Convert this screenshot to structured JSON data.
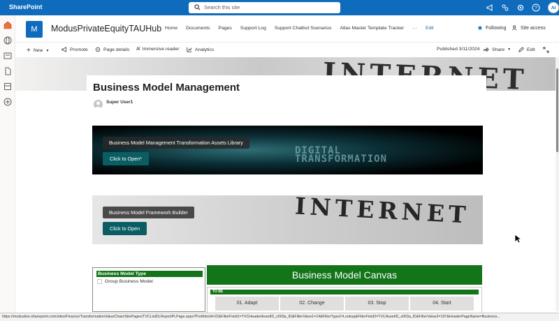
{
  "suitebar": {
    "brand": "SharePoint",
    "search_placeholder": "Search this site",
    "avatar_initials": "AI"
  },
  "site": {
    "logo_letter": "M",
    "title": "ModusPrivateEquityTAUHub",
    "nav": [
      "Home",
      "Documents",
      "Pages",
      "Support Log",
      "Support Chatbot Scenarios",
      "Atlas Master Template Tracker",
      "···",
      "Edit"
    ],
    "following": "Following",
    "site_access": "Site access"
  },
  "commandbar": {
    "new": "New",
    "promote": "Promote",
    "page_details": "Page details",
    "immersive_reader": "Immersive reader",
    "analytics": "Analytics",
    "published": "Published 3/11/2024",
    "share": "Share",
    "edit": "Edit"
  },
  "page": {
    "banner_word": "INTERNET",
    "title": "Business Model Management",
    "author": "Super User1"
  },
  "hero1": {
    "label": "Business Model Management Transformation Assets Library",
    "button": "Click to Open*",
    "image_text": "DIGITAL\nTRANSFORMATION"
  },
  "hero2": {
    "label": "Business Model Framework Builder",
    "button": "Click to Open",
    "image_text": "INTERNET"
  },
  "bm_type": {
    "header": "Business Model Type",
    "option": "Group Business Model"
  },
  "canvas": {
    "title": "Business Model Canvas",
    "section": "TO BE",
    "stages": [
      "01. Adapt",
      "02. Change",
      "03. Stop",
      "04. Start"
    ]
  },
  "status_url": "https://moduslive.sharepoint.com/sites/Finance/TransformationValueChain/SitePages/TVCListDLReportPLPage.aspx?PortfolioId=22&FilterField1=TVCHeaderAssetID_x003a_ID&FilterValue1=14&FilterType2=Lookup&FilterField2=TVCAssetID_x003a_ID&FilterValue2=197&HeaderPageName=Business..."
}
